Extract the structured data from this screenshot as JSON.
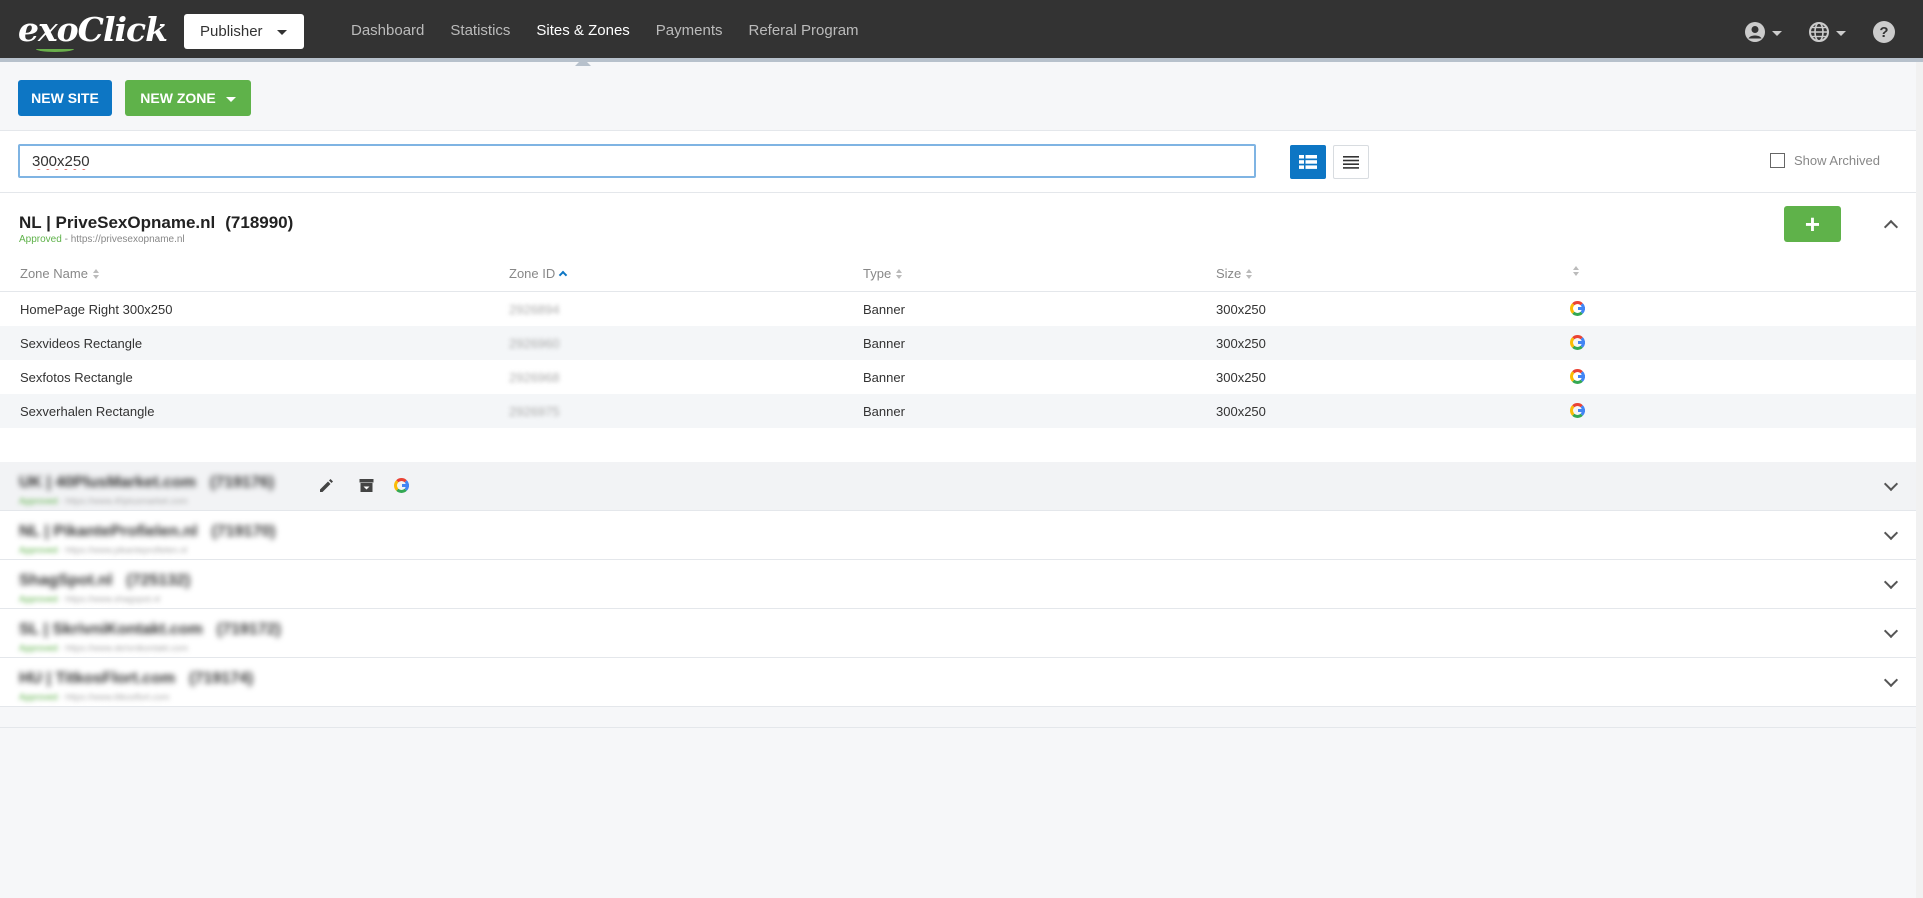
{
  "app": {
    "logo": "exoClick"
  },
  "topbar": {
    "role": "Publisher",
    "nav": [
      "Dashboard",
      "Statistics",
      "Sites & Zones",
      "Payments",
      "Referal Program"
    ],
    "active_nav": "Sites & Zones",
    "icons": [
      "user-icon",
      "globe-icon",
      "help-icon"
    ],
    "help_glyph": "?"
  },
  "actions": {
    "new_site": "NEW SITE",
    "new_zone": "NEW ZONE"
  },
  "filter": {
    "search_value": "300x250",
    "show_archived": "Show Archived",
    "show_archived_checked": false
  },
  "site": {
    "title": "NL | PriveSexOpname.nl",
    "id": "(718990)",
    "status": "Approved",
    "url_sep": " - ",
    "url": "https://privesexopname.nl",
    "add_glyph": "+",
    "columns": [
      "Zone Name",
      "Zone ID",
      "Type",
      "Size"
    ],
    "zones": [
      {
        "name": "HomePage Right 300x250",
        "zone_id": "2926894",
        "type": "Banner",
        "size": "300x250"
      },
      {
        "name": "Sexvideos Rectangle",
        "zone_id": "2926960",
        "type": "Banner",
        "size": "300x250"
      },
      {
        "name": "Sexfotos Rectangle",
        "zone_id": "2926968",
        "type": "Banner",
        "size": "300x250"
      },
      {
        "name": "Sexverhalen Rectangle",
        "zone_id": "2926975",
        "type": "Banner",
        "size": "300x250"
      }
    ]
  },
  "other_sites": [
    {
      "title": "UK | 40PlusMarket.com",
      "id": "(719176)",
      "status": "Approved",
      "url": "https://www.40plusmarket.com"
    },
    {
      "title": "NL | PikanteProfielen.nl",
      "id": "(719170)",
      "status": "Approved",
      "url": "https://www.pikanteprofielen.nl"
    },
    {
      "title": "ShagSpot.nl",
      "id": "(725132)",
      "status": "Approved",
      "url": "https://www.shagspot.nl"
    },
    {
      "title": "SL | SkrivniKontakt.com",
      "id": "(719172)",
      "status": "Approved",
      "url": "https://www.skrivnikontakt.com"
    },
    {
      "title": "HU | TitkosFlort.com",
      "id": "(719174)",
      "status": "Approved",
      "url": "https://www.titkosflort.com"
    }
  ],
  "colors": {
    "topbar": "#333333",
    "primary": "#0d76c4",
    "success": "#5fb24a",
    "background": "#f6f7f9"
  }
}
